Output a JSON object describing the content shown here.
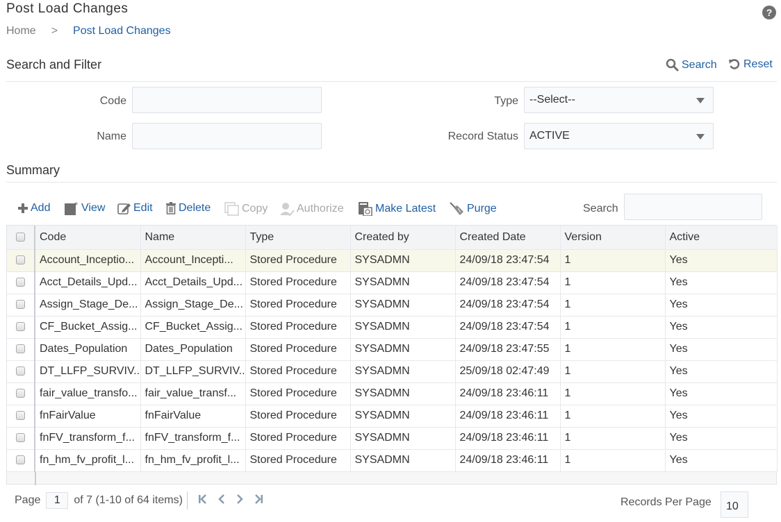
{
  "header": {
    "title": "Post Load Changes",
    "help_icon": "help-circle-icon",
    "help_glyph": "?"
  },
  "breadcrumb": {
    "home": "Home",
    "separator": ">",
    "current": "Post Load Changes"
  },
  "search_filter": {
    "title": "Search and Filter",
    "search_label": "Search",
    "reset_label": "Reset",
    "search_icon": "magnifier-icon",
    "reset_icon": "reset-arrow-icon",
    "fields": {
      "code": {
        "label": "Code",
        "value": "",
        "placeholder": ""
      },
      "name": {
        "label": "Name",
        "value": "",
        "placeholder": ""
      },
      "type": {
        "label": "Type",
        "selected": "--Select--"
      },
      "record_status": {
        "label": "Record Status",
        "selected": "ACTIVE"
      }
    }
  },
  "summary": {
    "title": "Summary",
    "toolbar": {
      "add": "Add",
      "view": "View",
      "edit": "Edit",
      "delete": "Delete",
      "copy": "Copy",
      "authorize": "Authorize",
      "make_latest": "Make Latest",
      "purge": "Purge",
      "search_label": "Search",
      "search_value": ""
    },
    "columns": [
      "Code",
      "Name",
      "Type",
      "Created by",
      "Created Date",
      "Version",
      "Active"
    ],
    "rows": [
      [
        "Account_Inceptio...",
        "Account_Incepti...",
        "Stored Procedure",
        "SYSADMN",
        "24/09/18 23:47:54",
        "1",
        "Yes"
      ],
      [
        "Acct_Details_Upd...",
        "Acct_Details_Upd...",
        "Stored Procedure",
        "SYSADMN",
        "24/09/18 23:47:54",
        "1",
        "Yes"
      ],
      [
        "Assign_Stage_De...",
        "Assign_Stage_De...",
        "Stored Procedure",
        "SYSADMN",
        "24/09/18 23:47:54",
        "1",
        "Yes"
      ],
      [
        "CF_Bucket_Assig...",
        "CF_Bucket_Assig...",
        "Stored Procedure",
        "SYSADMN",
        "24/09/18 23:47:54",
        "1",
        "Yes"
      ],
      [
        "Dates_Population",
        "Dates_Population",
        "Stored Procedure",
        "SYSADMN",
        "24/09/18 23:47:55",
        "1",
        "Yes"
      ],
      [
        "DT_LLFP_SURVIV...",
        "DT_LLFP_SURVIV...",
        "Stored Procedure",
        "SYSADMN",
        "25/09/18 02:47:49",
        "1",
        "Yes"
      ],
      [
        "fair_value_transfo...",
        "fair_value_transf...",
        "Stored Procedure",
        "SYSADMN",
        "24/09/18 23:46:11",
        "1",
        "Yes"
      ],
      [
        "fnFairValue",
        "fnFairValue",
        "Stored Procedure",
        "SYSADMN",
        "24/09/18 23:46:11",
        "1",
        "Yes"
      ],
      [
        "fnFV_transform_f...",
        "fnFV_transform_f...",
        "Stored Procedure",
        "SYSADMN",
        "24/09/18 23:46:11",
        "1",
        "Yes"
      ],
      [
        "fn_hm_fv_profit_l...",
        "fn_hm_fv_profit_l...",
        "Stored Procedure",
        "SYSADMN",
        "24/09/18 23:46:11",
        "1",
        "Yes"
      ]
    ],
    "highlighted_row": 0
  },
  "pagination": {
    "page_label": "Page",
    "current_page": "1",
    "of_text": "of 7 (1-10 of 64 items)",
    "first_glyph": "K",
    "prev_glyph": "<",
    "next_glyph": ">",
    "last_glyph": "❘K",
    "records_per_page_label": "Records Per Page",
    "records_per_page": "10"
  },
  "colors": {
    "link": "#1f5fa3",
    "disabled": "#a8a8a8",
    "selected_row": "#f7f8ea",
    "header_bg": "#f3f4f6"
  }
}
